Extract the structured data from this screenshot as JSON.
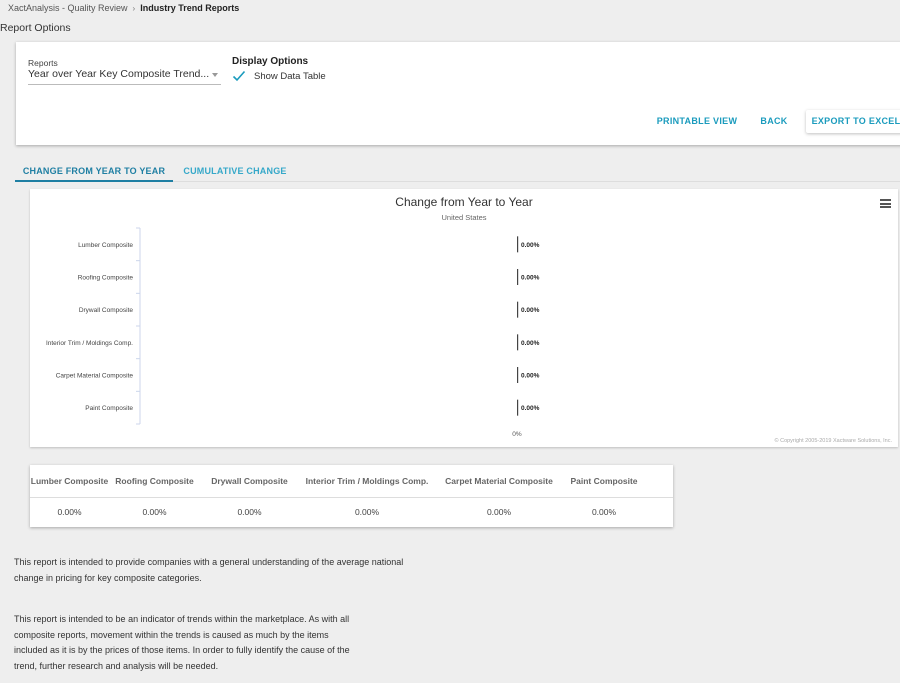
{
  "breadcrumb": {
    "parent": "XactAnalysis - Quality Review",
    "current": "Industry Trend Reports"
  },
  "page_title": "Report Options",
  "options": {
    "reports_label": "Reports",
    "reports_value": "Year over Year Key Composite Trend...",
    "display_title": "Display Options",
    "show_data_table_label": "Show Data Table",
    "show_data_table_checked": true
  },
  "actions": {
    "printable": "PRINTABLE VIEW",
    "back": "BACK",
    "export": "EXPORT TO EXCEL"
  },
  "tabs": [
    {
      "label": "CHANGE FROM YEAR TO YEAR",
      "active": true
    },
    {
      "label": "CUMULATIVE CHANGE",
      "active": false
    }
  ],
  "colors": {
    "accent": "#1a9bbd",
    "active_tab": "#1f7fa3"
  },
  "chart_data": {
    "type": "bar",
    "orientation": "horizontal",
    "title": "Change from Year to Year",
    "subtitle": "United States",
    "categories": [
      "Lumber Composite",
      "Roofing Composite",
      "Drywall Composite",
      "Interior Trim / Moldings Comp.",
      "Carpet Material Composite",
      "Paint Composite"
    ],
    "values": [
      0,
      0,
      0,
      0,
      0,
      0
    ],
    "data_labels": [
      "0.00%",
      "0.00%",
      "0.00%",
      "0.00%",
      "0.00%",
      "0.00%"
    ],
    "x_tick_labels": [
      "0%"
    ],
    "credits": "© Copyright 2005-2019 Xactware Solutions, Inc."
  },
  "data_table": {
    "headers": [
      "Lumber Composite",
      "Roofing Composite",
      "Drywall Composite",
      "Interior Trim / Moldings Comp.",
      "Carpet Material Composite",
      "Paint Composite"
    ],
    "values": [
      "0.00%",
      "0.00%",
      "0.00%",
      "0.00%",
      "0.00%",
      "0.00%"
    ]
  },
  "description": {
    "p1": "This report is intended to provide companies with a general understanding of the average national change in pricing for key composite categories.",
    "p2": "This report is intended to be an indicator of trends within the marketplace. As with all composite reports, movement within the trends is caused as much by the items included as it is by the prices of those items. In order to fully identify the cause of the trend, further research and analysis will be needed."
  }
}
